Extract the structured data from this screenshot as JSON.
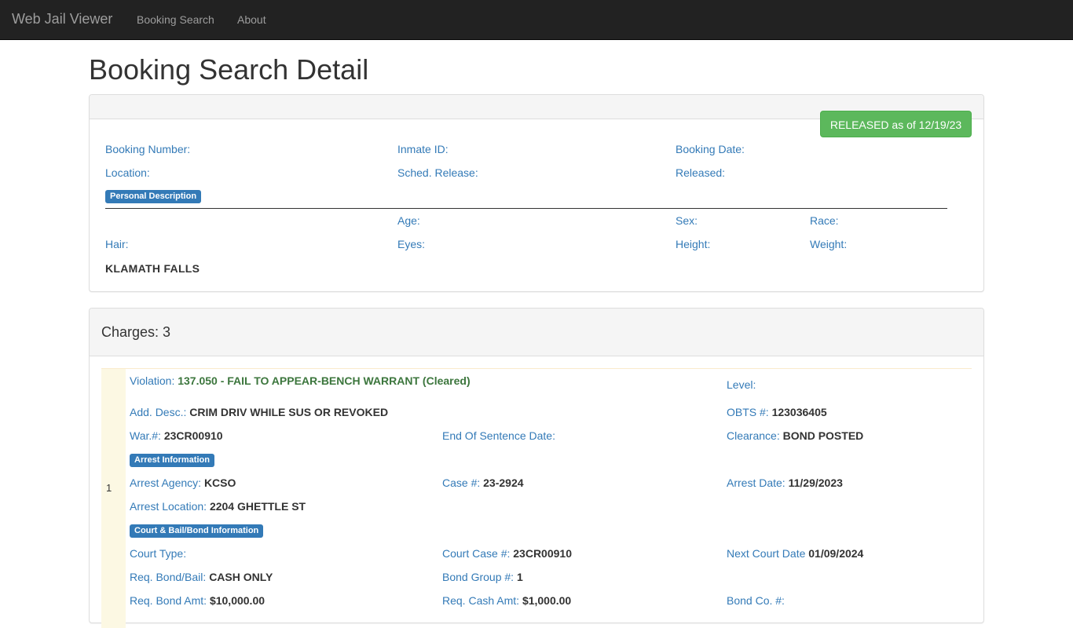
{
  "nav": {
    "brand": "Web Jail Viewer",
    "links": [
      "Booking Search",
      "About"
    ]
  },
  "page_title": "Booking Search Detail",
  "booking": {
    "status": "RELEASED as of 12/19/23",
    "labels": {
      "booking_number": "Booking Number:",
      "inmate_id": "Inmate ID:",
      "booking_date": "Booking Date:",
      "location": "Location:",
      "sched_release": "Sched. Release:",
      "released": "Released:"
    },
    "personal_section": "Personal Description",
    "personal_labels": {
      "age": "Age:",
      "sex": "Sex:",
      "race": "Race:",
      "hair": "Hair:",
      "eyes": "Eyes:",
      "height": "Height:",
      "weight": "Weight:"
    },
    "city": "KLAMATH FALLS"
  },
  "charges": {
    "title": "Charges: 3",
    "items": [
      {
        "number": "1",
        "violation_label": "Violation:",
        "violation_value": "137.050 - FAIL TO APPEAR-BENCH WARRANT (Cleared)",
        "level_label": "Level:",
        "add_desc_label": "Add. Desc.:",
        "add_desc_value": "CRIM DRIV WHILE SUS OR REVOKED",
        "obts_label": "OBTS #:",
        "obts_value": "123036405",
        "war_label": "War.#:",
        "war_value": "23CR00910",
        "end_sentence_label": "End Of Sentence Date:",
        "clearance_label": "Clearance:",
        "clearance_value": "BOND POSTED",
        "arrest_section": "Arrest Information",
        "arrest_agency_label": "Arrest Agency:",
        "arrest_agency_value": "KCSO",
        "case_label": "Case #:",
        "case_value": "23-2924",
        "arrest_date_label": "Arrest Date:",
        "arrest_date_value": "11/29/2023",
        "arrest_location_label": "Arrest Location:",
        "arrest_location_value": "2204 GHETTLE ST",
        "court_section": "Court & Bail/Bond Information",
        "court_type_label": "Court Type:",
        "court_case_label": "Court Case #:",
        "court_case_value": "23CR00910",
        "next_court_label": "Next Court Date",
        "next_court_value": "01/09/2024",
        "req_bond_label": "Req. Bond/Bail:",
        "req_bond_value": "CASH ONLY",
        "bond_group_label": "Bond Group #:",
        "bond_group_value": "1",
        "bond_amt_label": "Req. Bond Amt:",
        "bond_amt_value": "$10,000.00",
        "cash_amt_label": "Req. Cash Amt:",
        "cash_amt_value": "$1,000.00",
        "bond_co_label": "Bond Co. #:"
      }
    ]
  }
}
